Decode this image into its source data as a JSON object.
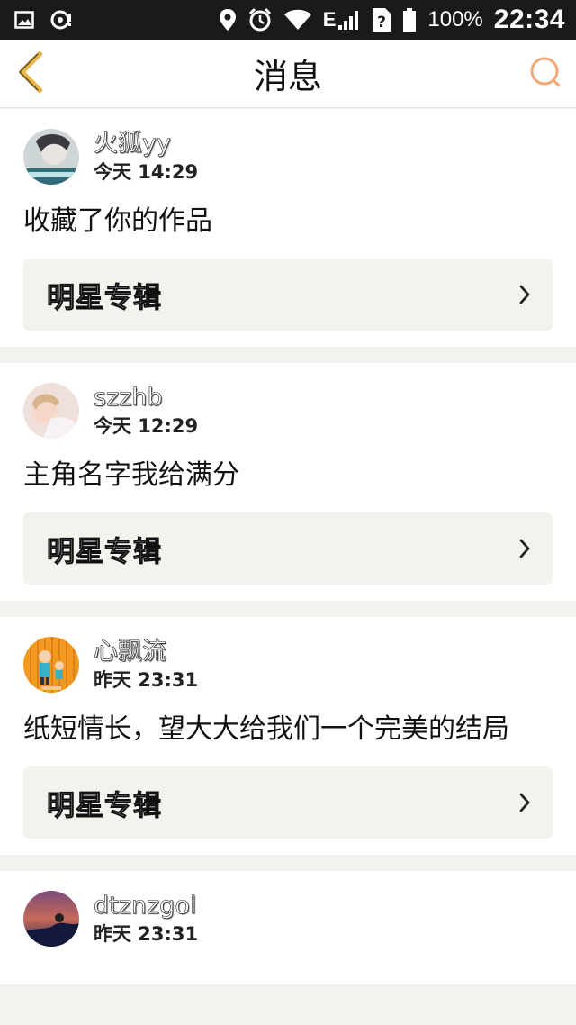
{
  "status_bar": {
    "network": "E",
    "battery": "100%",
    "time": "22:34",
    "icons": [
      "image-icon",
      "pin-icon",
      "location-icon",
      "alarm-icon",
      "wifi-icon",
      "signal-icon",
      "sim-unknown-icon",
      "battery-icon"
    ]
  },
  "nav": {
    "title": "消息",
    "back_icon": "chevron-left-icon",
    "search_icon": "search-icon",
    "accent_color": "#e8b64a",
    "search_color": "#f0a878"
  },
  "messages": [
    {
      "user": "火狐yy",
      "time": "今天 14:29",
      "text": "收藏了你的作品",
      "link_label": "明星专辑"
    },
    {
      "user": "szzhb",
      "time": "今天 12:29",
      "text": "主角名字我给满分",
      "link_label": "明星专辑"
    },
    {
      "user": "心飘流",
      "time": "昨天 23:31",
      "text": "纸短情长，望大大给我们一个完美的结局",
      "link_label": "明星专辑"
    },
    {
      "user": "dtznzgol",
      "time": "昨天 23:31",
      "text": "",
      "link_label": ""
    }
  ]
}
